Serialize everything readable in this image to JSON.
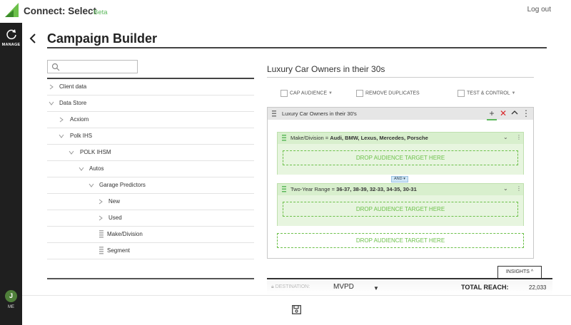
{
  "app": {
    "title": "Connect: Select",
    "beta": "Beta",
    "logout": "Log out"
  },
  "sidebar": {
    "manage_label": "MANAGE",
    "avatar_initial": "J",
    "me_label": "ME"
  },
  "page": {
    "title": "Campaign Builder"
  },
  "search": {
    "placeholder": ""
  },
  "tree": [
    {
      "label": "Client data",
      "icon": "chevron-right-icon"
    },
    {
      "label": "Data Store",
      "icon": "chevron-down-icon"
    },
    {
      "label": "Acxiom",
      "icon": "chevron-right-icon"
    },
    {
      "label": "Polk IHS",
      "icon": "chevron-down-icon"
    },
    {
      "label": "POLK IHSM",
      "icon": "chevron-down-icon"
    },
    {
      "label": "Autos",
      "icon": "chevron-down-icon"
    },
    {
      "label": "Garage Predictors",
      "icon": "chevron-down-icon"
    },
    {
      "label": "New",
      "icon": "chevron-right-icon"
    },
    {
      "label": "Used",
      "icon": "chevron-right-icon"
    },
    {
      "label": "Make/Division",
      "icon": "drag-handle-icon"
    },
    {
      "label": "Segment",
      "icon": "drag-handle-icon"
    }
  ],
  "segment": {
    "title": "Luxury Car Owners in their 30s"
  },
  "options": {
    "cap_audience": "CAP AUDIENCE",
    "remove_duplicates": "REMOVE DUPLICATES",
    "test_control": "TEST & CONTROL"
  },
  "builder": {
    "name": "Luxury Car Owners in their 30's",
    "groups": [
      {
        "key": "Make/Division",
        "values": "Audi, BMW, Lexus, Mercedes, Porsche",
        "drop_label": "DROP AUDIENCE TARGET HERE"
      },
      {
        "key": "Two-Year Range",
        "values": "36-37, 38-39, 32-33, 34-35, 30-31",
        "drop_label": "DROP AUDIENCE TARGET HERE"
      }
    ],
    "and_label": "AND",
    "drop_label": "DROP AUDIENCE TARGET HERE"
  },
  "insights": {
    "tab_label": "INSIGHTS"
  },
  "bottom": {
    "destination_label": "DESTINATION:",
    "destination_value": "MVPD",
    "reach_label": "TOTAL REACH:",
    "reach_value": "22,033"
  },
  "colors": {
    "accent_green": "#5cb85c",
    "group_bg": "#d8efcd",
    "sidebar_bg": "#1f1f1f",
    "danger_red": "#d9252a"
  }
}
